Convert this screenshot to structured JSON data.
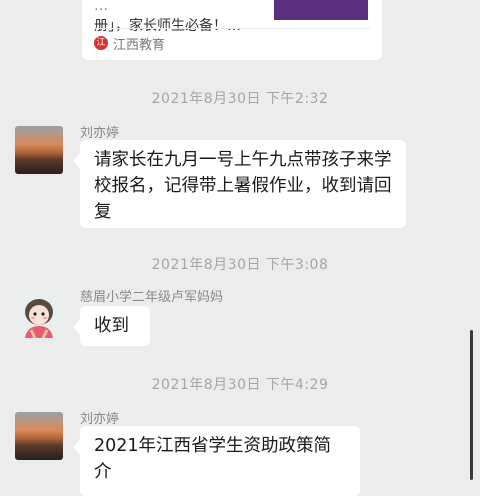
{
  "shared_article": {
    "title_line1": "…",
    "title_line2": "册」，家长师生必备！…",
    "source_icon_text": "江",
    "source_name": "江西教育"
  },
  "messages": [
    {
      "timestamp": "2021年8月30日 下午2:32",
      "sender": "刘亦婷",
      "avatar": "sunset-avatar",
      "text": "请家长在九月一号上午九点带孩子来学校报名，记得带上暑假作业，收到请回复"
    },
    {
      "timestamp": "2021年8月30日 下午3:08",
      "sender": "慈眉小学二年级卢军妈妈",
      "avatar": "cartoon-girl-avatar",
      "text": "收到"
    },
    {
      "timestamp": "2021年8月30日 下午4:29",
      "sender": "刘亦婷",
      "avatar": "sunset-avatar",
      "text": "2021年江西省学生资助政策简介"
    }
  ],
  "colors": {
    "background": "#ececec",
    "bubble": "#ffffff",
    "timestamp": "#a6a6a6",
    "source_icon": "#d9302c"
  }
}
